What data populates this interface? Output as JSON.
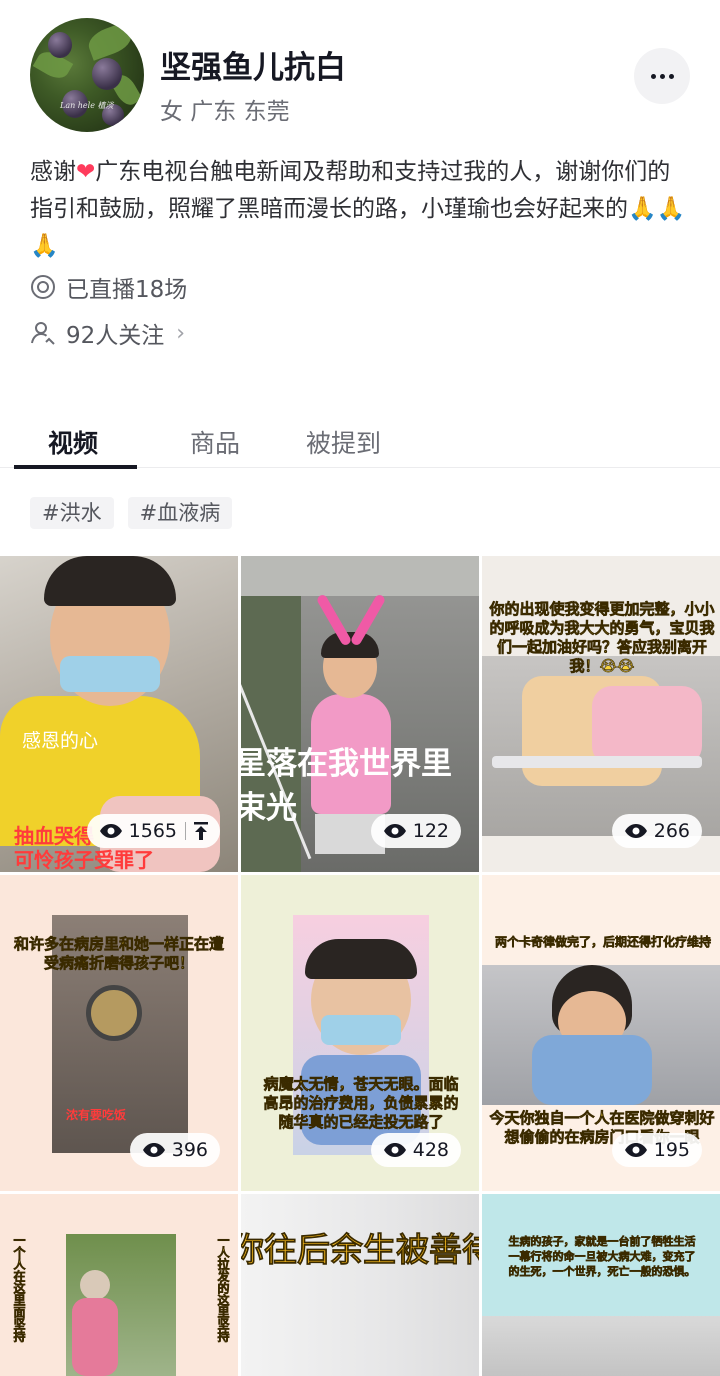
{
  "profile": {
    "name": "坚强鱼儿抗白",
    "location": "女 广东 东莞",
    "bio_before_heart": "感谢",
    "bio_heart": "❤",
    "bio_after_heart": "广东电视台触电新闻及帮助和支持过我的人，谢谢你们的指引和鼓励，照耀了黑暗而漫长的路，小瑾瑜也会好起来的🙏🙏🙏",
    "live_count": "已直播18场",
    "following": "92人关注",
    "avatar_signature": "Lan hele 植淡"
  },
  "tabs": [
    {
      "label": "视频"
    },
    {
      "label": "商品"
    },
    {
      "label": "被提到"
    }
  ],
  "chips": [
    "#洪水",
    "#血液病"
  ],
  "videos": [
    {
      "views": "1565",
      "caption1": "感恩的心",
      "caption2": "抽血哭得\n可怜孩子受罪了"
    },
    {
      "views": "122",
      "caption1": "星落在我世界里",
      "caption2": "束光"
    },
    {
      "views": "266",
      "caption1": "你的出现使我变得更加完整，小小的呼吸成为我大大的勇气，宝贝我们一起加油好吗？答应我别离开我！😭😭"
    },
    {
      "views": "396",
      "caption1": "和许多在病房里和她一样正在遭受病痛折磨得孩子吧！",
      "caption2": "浓有要吃饭"
    },
    {
      "views": "428",
      "caption1": "病魔太无情，苍天无眼。面临高昂的治疗费用，负债累累的随华真的已经走投无路了"
    },
    {
      "views": "195",
      "caption1": "两个卡奇律做完了，后期还得打化疗维持",
      "caption2": "今天你独自一个人在医院做穿刺好想偷偷的在病房门口看你一眼"
    },
    {
      "caption1": "一个人在这里面坚持",
      "caption2": "一人拉发的这里坚持"
    },
    {
      "caption1": "你往后余生被善待"
    },
    {
      "caption1": "生病的孩子，家就是一台前了牺牲生活一幕行将的命一旦被大病大难，变充了的生死，一个世界，死亡一般的恐惧。"
    }
  ],
  "colors": {
    "accent_red": "#ff3b5c",
    "text_primary": "#161823",
    "text_secondary": "#6b6d75",
    "caption_yellow": "#f7d33c"
  }
}
